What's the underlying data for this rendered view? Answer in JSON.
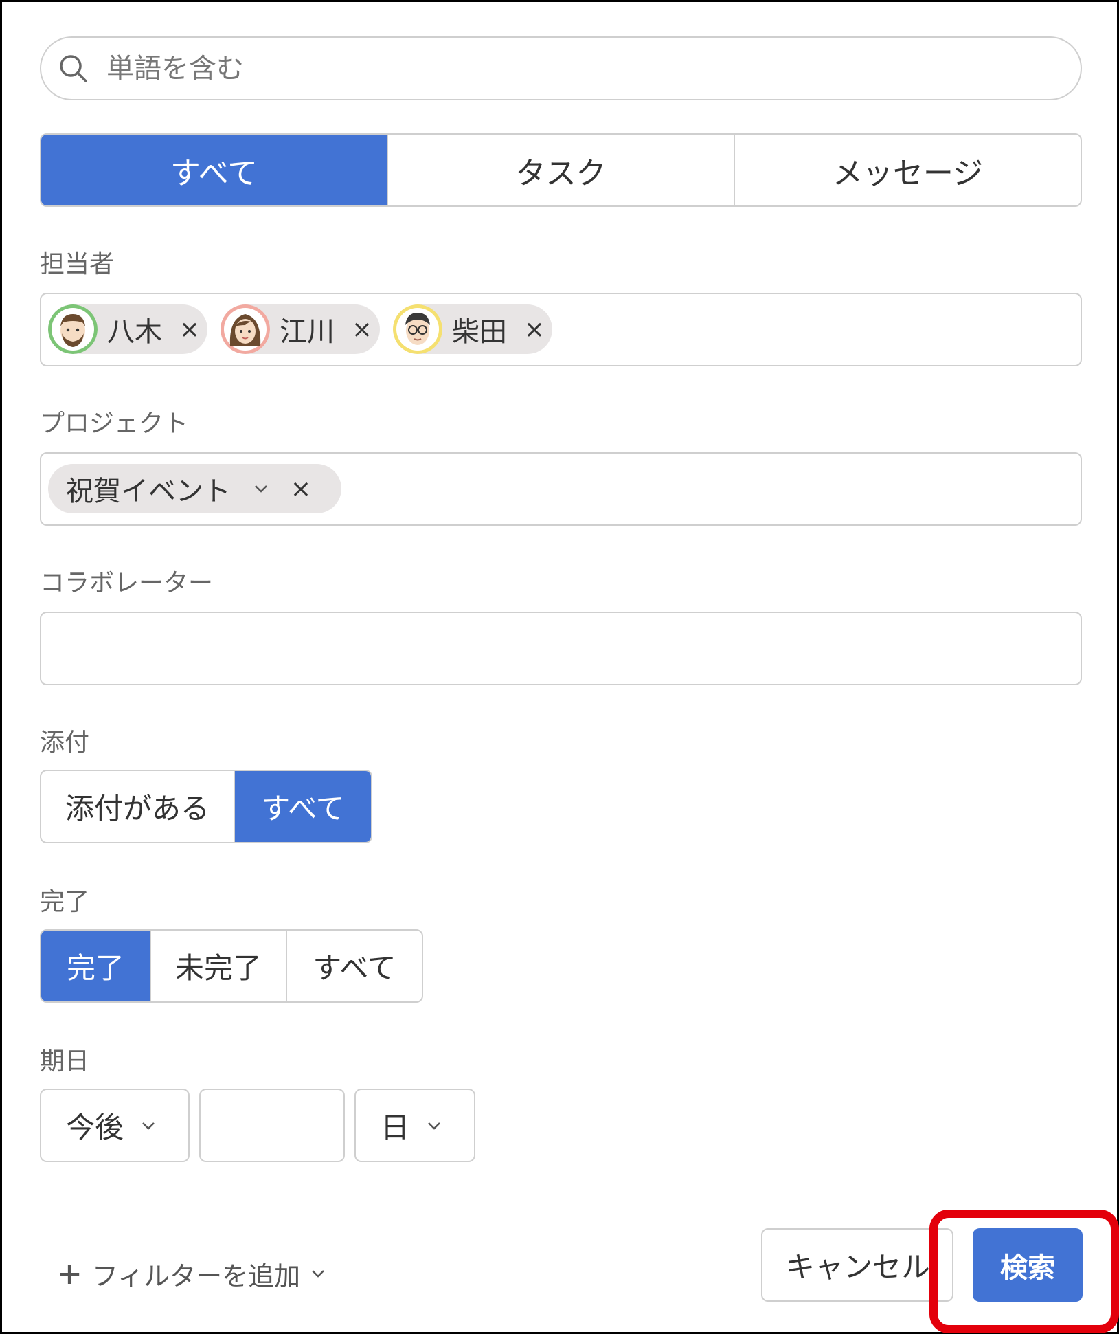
{
  "search": {
    "placeholder": "単語を含む"
  },
  "type_tabs": [
    {
      "label": "すべて",
      "active": true
    },
    {
      "label": "タスク",
      "active": false
    },
    {
      "label": "メッセージ",
      "active": false
    }
  ],
  "assignee": {
    "label": "担当者",
    "chips": [
      {
        "name": "八木",
        "avatar_color": "#7cc576"
      },
      {
        "name": "江川",
        "avatar_color": "#f2a9a0"
      },
      {
        "name": "柴田",
        "avatar_color": "#f5e070"
      }
    ],
    "remove_glyph": "×"
  },
  "project": {
    "label": "プロジェクト",
    "chip": {
      "name": "祝賀イベント"
    },
    "remove_glyph": "×"
  },
  "collaborator": {
    "label": "コラボレーター",
    "value": ""
  },
  "attachment": {
    "label": "添付",
    "options": [
      {
        "label": "添付がある",
        "active": false
      },
      {
        "label": "すべて",
        "active": true
      }
    ]
  },
  "completion": {
    "label": "完了",
    "options": [
      {
        "label": "完了",
        "active": true
      },
      {
        "label": "未完了",
        "active": false
      },
      {
        "label": "すべて",
        "active": false
      }
    ]
  },
  "due_date": {
    "label": "期日",
    "direction": "今後",
    "amount": "",
    "unit": "日"
  },
  "footer": {
    "add_filter_plus": "+",
    "add_filter_label": "フィルターを追加",
    "cancel_label": "キャンセル",
    "search_label": "検索"
  },
  "colors": {
    "accent": "#4273d4",
    "highlight": "#e3000b",
    "chip_bg": "#e8e5e5"
  }
}
